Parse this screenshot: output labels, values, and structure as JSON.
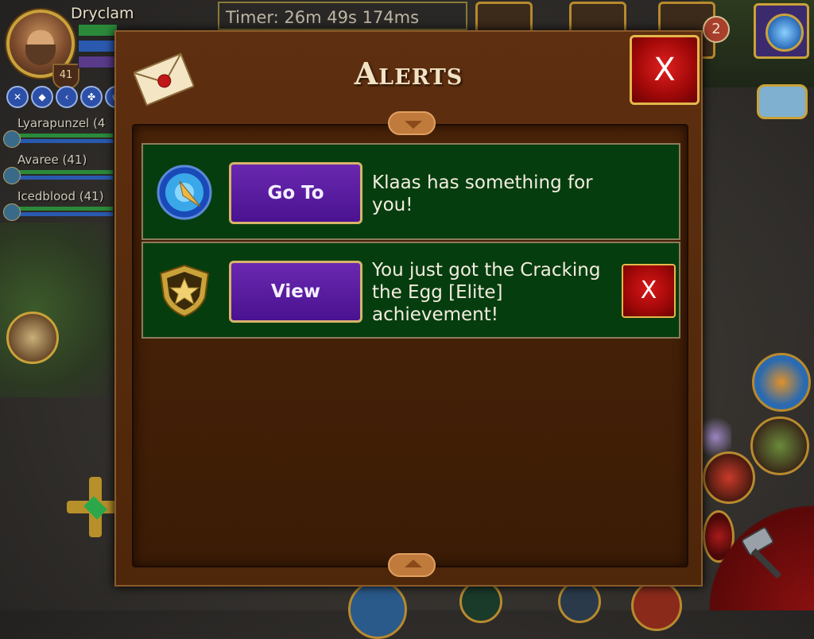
{
  "player": {
    "name": "Dryclam",
    "level": "41"
  },
  "party": [
    {
      "name": "Lyarapunzel (4"
    },
    {
      "name": "Avaree (41)"
    },
    {
      "name": "Icedblood (41)"
    }
  ],
  "hud": {
    "timer": "Timer: 26m 49s 174ms",
    "notification_count": "2"
  },
  "dialog": {
    "title": "Alerts",
    "close_label": "X",
    "alerts": [
      {
        "icon": "compass-icon",
        "button_label": "Go To",
        "message": "Klaas has something for you!",
        "dismissable": false
      },
      {
        "icon": "star-shield-icon",
        "button_label": "View",
        "message": "You just got the Cracking the Egg [Elite] achievement!",
        "dismiss_label": "X",
        "dismissable": true
      }
    ]
  },
  "colors": {
    "dialog_bg": "#5e2f10",
    "row_bg": "#063d0e",
    "action_button": "#6a28b0",
    "close_button": "#c01010",
    "gold_border": "#d7b46a"
  }
}
